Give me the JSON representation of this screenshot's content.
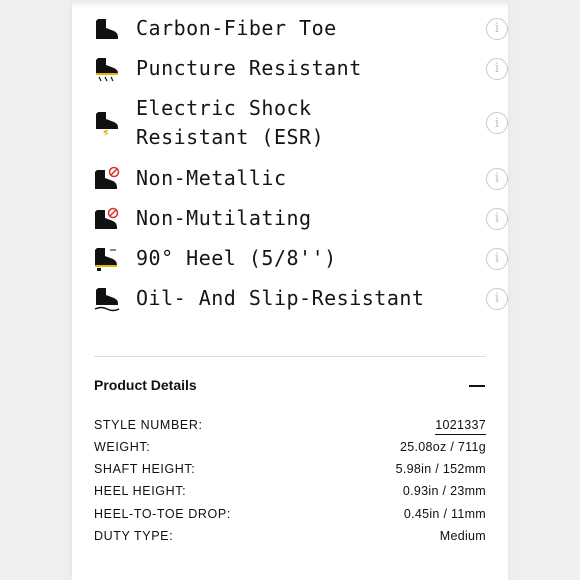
{
  "features": [
    {
      "icon": "carbon-fiber-toe-boot-icon",
      "label": "Carbon-Fiber Toe",
      "info_glyph": "i"
    },
    {
      "icon": "puncture-resistant-boot-icon",
      "label": "Puncture Resistant",
      "info_glyph": "i"
    },
    {
      "icon": "electric-shock-boot-icon",
      "label": "Electric Shock Resistant (ESR)",
      "info_glyph": "i"
    },
    {
      "icon": "non-metallic-boot-icon",
      "label": "Non-Metallic",
      "info_glyph": "i"
    },
    {
      "icon": "non-mutilating-boot-icon",
      "label": "Non-Mutilating",
      "info_glyph": "i"
    },
    {
      "icon": "heel-90-boot-icon",
      "label": "90° Heel (5/8'')",
      "info_glyph": "i"
    },
    {
      "icon": "oil-slip-resistant-boot-icon",
      "label": "Oil- And Slip-Resistant",
      "info_glyph": "i"
    }
  ],
  "product_details": {
    "title": "Product Details",
    "collapse_icon": "minus-icon",
    "specs": [
      {
        "label": "STYLE NUMBER:",
        "value": "1021337"
      },
      {
        "label": "WEIGHT:",
        "value": "25.08oz / 711g"
      },
      {
        "label": "SHAFT HEIGHT:",
        "value": "5.98in / 152mm"
      },
      {
        "label": "HEEL HEIGHT:",
        "value": "0.93in / 23mm"
      },
      {
        "label": "HEEL-TO-TOE DROP:",
        "value": "0.45in / 11mm"
      },
      {
        "label": "DUTY TYPE:",
        "value": "Medium"
      }
    ]
  },
  "colors": {
    "text": "#151515",
    "info_icon": "#c0c0c0",
    "divider": "#dcdcdc",
    "accent_yellow": "#e8b400",
    "accent_red": "#d8322a"
  }
}
